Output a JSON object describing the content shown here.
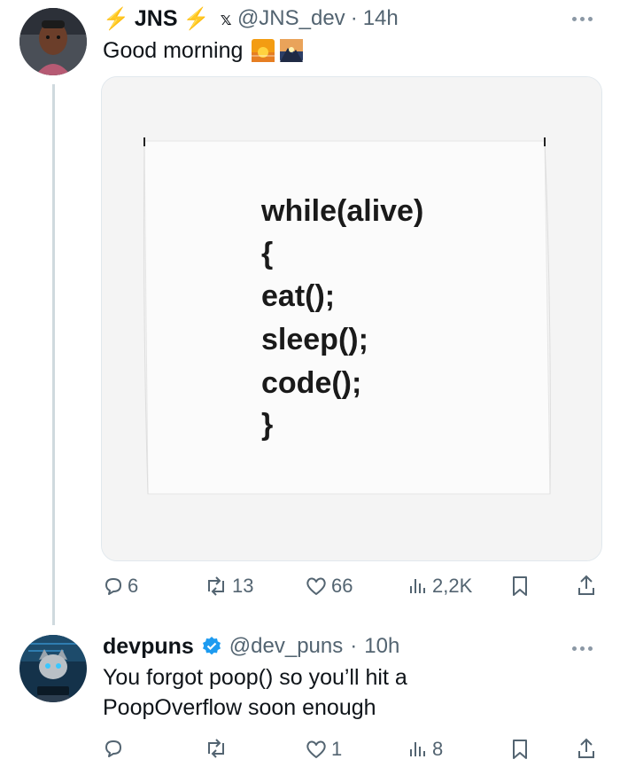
{
  "tweet": {
    "display_name": "JNS",
    "badge_emoji": "⚡",
    "x_mark": "𝕩",
    "handle": "@JNS_dev",
    "separator": "·",
    "time": "14h",
    "text": "Good morning",
    "media_code": [
      "while(alive)",
      "{",
      "eat();",
      "sleep();",
      "code();",
      "}"
    ],
    "actions": {
      "replies": "6",
      "reposts": "13",
      "likes": "66",
      "views": "2,2K"
    }
  },
  "reply": {
    "display_name": "devpuns",
    "handle": "@dev_puns",
    "separator": "·",
    "time": "10h",
    "text_line1": "You forgot poop() so you’ll hit a",
    "text_line2": "PoopOverflow soon enough",
    "actions": {
      "replies": "",
      "reposts": "",
      "likes": "1",
      "views": "8"
    }
  },
  "colors": {
    "verified": "#1d9bf0",
    "lightning": "#f7b500",
    "muted": "#536471"
  },
  "icons": [
    "reply-icon",
    "repost-icon",
    "like-icon",
    "views-icon",
    "bookmark-icon",
    "share-icon",
    "more-icon",
    "verified-icon"
  ]
}
